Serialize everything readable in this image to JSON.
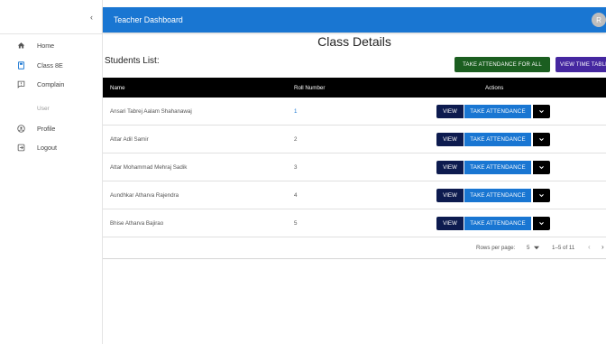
{
  "topbar": {
    "title": "Teacher Dashboard",
    "avatar_initial": "R"
  },
  "sidebar": {
    "collapse_glyph": "‹",
    "items": [
      {
        "label": "Home",
        "icon": "home-icon"
      },
      {
        "label": "Class 8E",
        "icon": "class-icon"
      },
      {
        "label": "Complain",
        "icon": "complain-icon"
      }
    ],
    "section_label": "User",
    "user_items": [
      {
        "label": "Profile",
        "icon": "profile-icon"
      },
      {
        "label": "Logout",
        "icon": "logout-icon"
      }
    ]
  },
  "main": {
    "page_title": "Class Details",
    "list_title": "Students List:",
    "take_all_label": "TAKE ATTENDANCE FOR ALL",
    "view_timetable_label": "VIEW TIME TABLE",
    "columns": {
      "name": "Name",
      "roll": "Roll Number",
      "actions": "Actions"
    },
    "rows": [
      {
        "name": "Ansari Tabrej Aalam Shahanawaj",
        "roll": "1"
      },
      {
        "name": "Attar Adil Samir",
        "roll": "2"
      },
      {
        "name": "Attar Mohammad Mehraj Sadik",
        "roll": "3"
      },
      {
        "name": "Aundhkar Atharva Rajendra",
        "roll": "4"
      },
      {
        "name": "Bhise Atharva Bajirao",
        "roll": "5"
      }
    ],
    "view_label": "VIEW",
    "take_label": "TAKE ATTENDANCE",
    "pager": {
      "rows_per_page_label": "Rows per page:",
      "rows_per_page": "5",
      "range": "1–5 of 11"
    }
  }
}
